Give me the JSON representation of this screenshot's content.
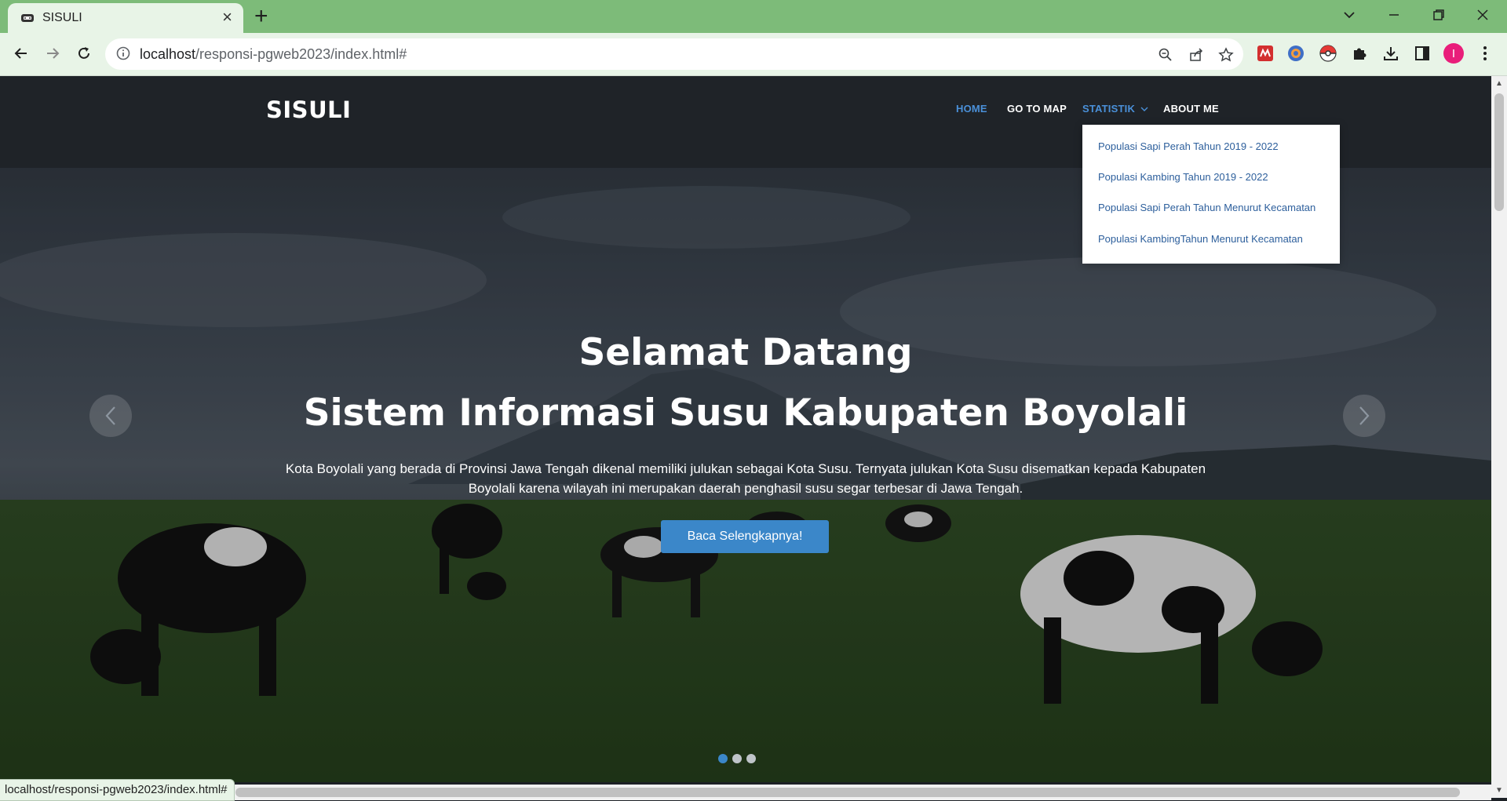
{
  "browser": {
    "tab_title": "SISULI",
    "tab_close": "×",
    "new_tab": "+",
    "url_host": "localhost",
    "url_path": "/responsi-pgweb2023/index.html#",
    "profile_initial": "I",
    "status_url": "localhost/responsi-pgweb2023/index.html#"
  },
  "site": {
    "brand": "SISULI",
    "nav": {
      "home": "HOME",
      "map": "GO TO MAP",
      "statistik": "STATISTIK",
      "about": "ABOUT ME"
    },
    "dropdown": [
      "Populasi Sapi Perah Tahun 2019 - 2022",
      "Populasi Kambing Tahun 2019 - 2022",
      "Populasi Sapi Perah Tahun Menurut Kecamatan",
      "Populasi KambingTahun Menurut Kecamatan"
    ],
    "hero": {
      "title": "Selamat Datang",
      "subtitle": "Sistem Informasi Susu Kabupaten Boyolali",
      "text": "Kota Boyolali yang berada di Provinsi Jawa Tengah dikenal memiliki julukan sebagai Kota Susu. Ternyata julukan Kota Susu disematkan kepada Kabupaten Boyolali karena wilayah ini merupakan daerah penghasil susu segar terbesar di Jawa Tengah.",
      "button": "Baca Selengkapnya!"
    },
    "carousel": {
      "slide_count": 3,
      "active_slide": 1
    }
  },
  "colors": {
    "tabbar": "#7dbb79",
    "toolbar": "#e8f4e7",
    "nav_active": "#4a90d9",
    "accent": "#3b87c9"
  }
}
